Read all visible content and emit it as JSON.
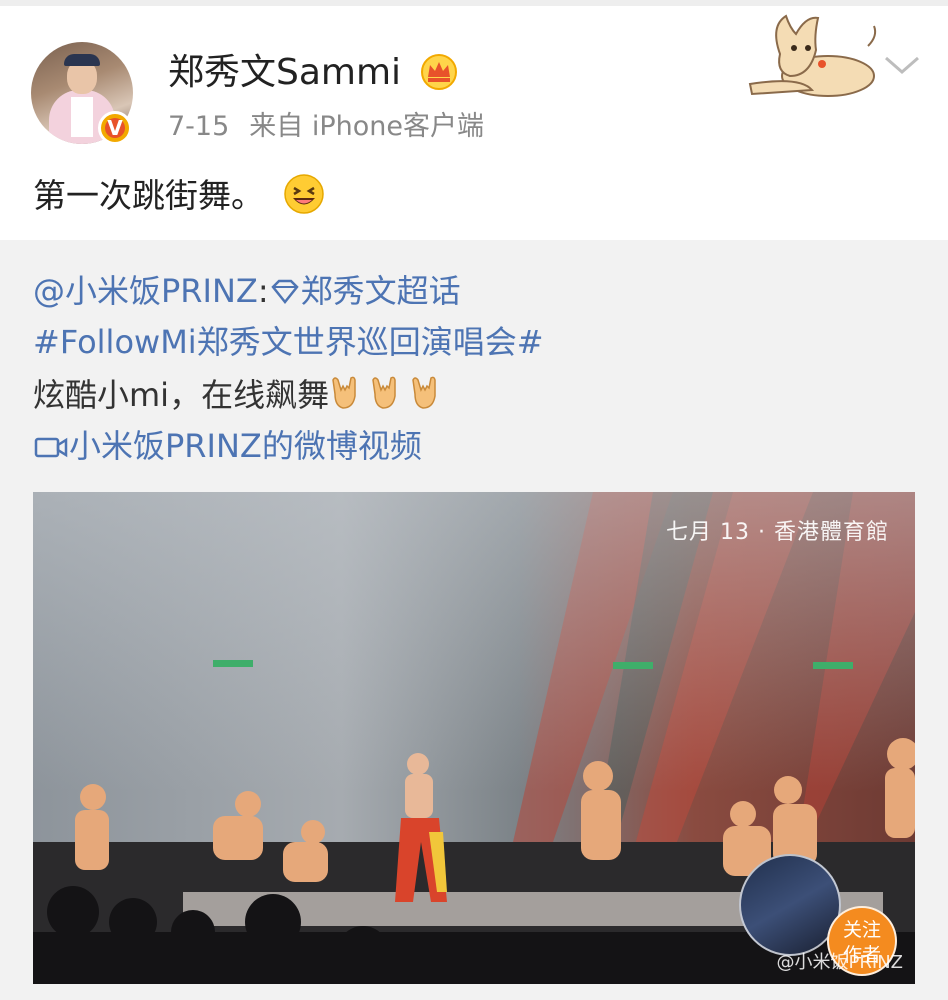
{
  "post": {
    "author_name": "郑秀文Sammi",
    "date": "7-15",
    "source": "来自 iPhone客户端",
    "text": "第一次跳街舞。",
    "emoji": "laughing-face-icon",
    "crown_icon": "crown-icon",
    "verified_badge": "V"
  },
  "repost": {
    "mention": "@小米饭PRINZ",
    "colon": ":",
    "super_topic": "郑秀文超话",
    "hashtag": "#FollowMi郑秀文世界巡回演唱会#",
    "body": "炫酷小mi，在线飙舞",
    "gesture_emoji": "rock-on-hand-icon",
    "video_link": "小米饭PRINZ的微博视频"
  },
  "video": {
    "caption": "七月 13 · 香港體育館",
    "follow_button": "关注\n作者",
    "follow_line1": "关注",
    "follow_line2": "作者",
    "watermark": "@小米饭PRINZ"
  },
  "colors": {
    "link": "#4d74b3",
    "follow_orange": "#f48b1f",
    "repost_bg": "#f2f2f2"
  }
}
